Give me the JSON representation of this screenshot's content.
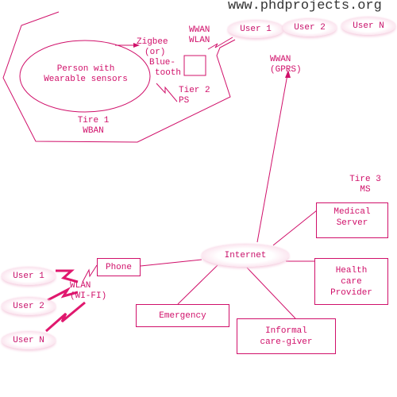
{
  "watermark": "www.phdprojects.org",
  "colors": {
    "line": "#d0106a",
    "cloud": "#f4c2d8",
    "watermark": "#333333"
  },
  "tier1": {
    "person": [
      "Person with",
      "Wearable sensors"
    ],
    "link_label": [
      "Zigbee",
      "(or)",
      "Blue-",
      "tooth"
    ],
    "label": [
      "Tire 1",
      "WBAN"
    ]
  },
  "tier2": {
    "label": [
      "Tier 2",
      "PS"
    ],
    "wwan_wlan": [
      "WWAN",
      "WLAN"
    ],
    "wwan_gprs": [
      "WWAN",
      "(GPRS)"
    ],
    "top_users": [
      "User 1",
      "User 2",
      "User N"
    ]
  },
  "tier3": {
    "label": [
      "Tire 3",
      "MS"
    ],
    "internet": "Internet",
    "medical_server": [
      "Medical",
      "Server"
    ],
    "health_care_provider": [
      "Health",
      "care",
      "Provider"
    ],
    "emergency": "Emergency",
    "informal_caregiver": [
      "Informal",
      "care-giver"
    ]
  },
  "wlan_side": {
    "phone": "Phone",
    "wlan_label": [
      "WLAN",
      "(WI-FI)"
    ],
    "users": [
      "User 1",
      "User 2",
      "User N"
    ]
  }
}
